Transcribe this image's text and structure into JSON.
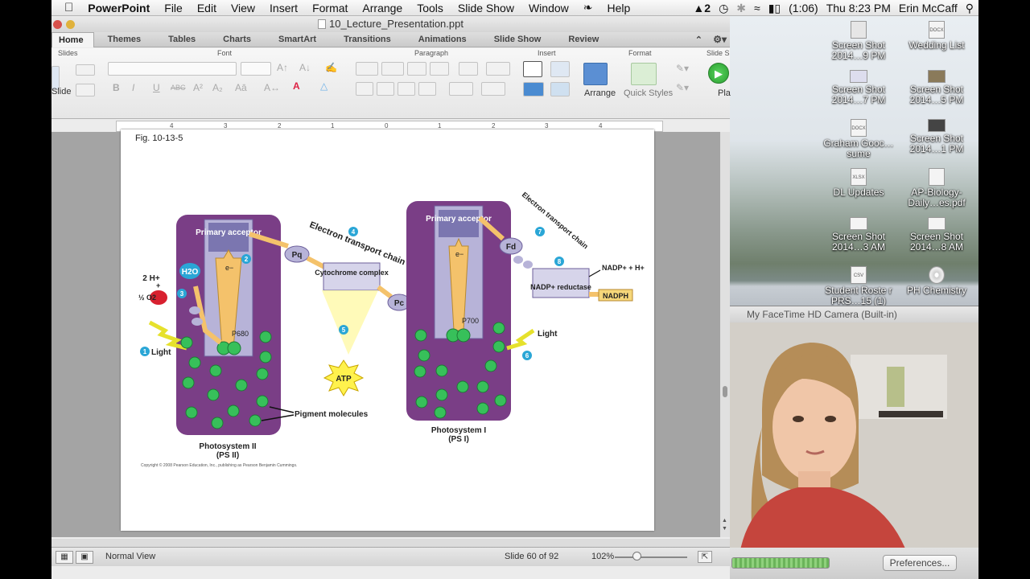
{
  "menubar": {
    "apple_icon": "apple-icon",
    "app_name": "PowerPoint",
    "menus": [
      "File",
      "Edit",
      "View",
      "Insert",
      "Format",
      "Arrange",
      "Tools",
      "Slide Show",
      "Window",
      "Help"
    ],
    "adobe_badge": "2",
    "battery": "(1:06)",
    "clock": "Thu 8:23 PM",
    "user": "Erin McCaff"
  },
  "window": {
    "title": "10_Lecture_Presentation.ppt"
  },
  "ribbon": {
    "tabs": [
      "Home",
      "Themes",
      "Tables",
      "Charts",
      "SmartArt",
      "Transitions",
      "Animations",
      "Slide Show",
      "Review"
    ],
    "active_tab": "Home",
    "groups": [
      "Slides",
      "Font",
      "Paragraph",
      "Insert",
      "Format",
      "Slide S"
    ],
    "slide_label": "Slide",
    "arrange_label": "Arrange",
    "quick_styles_label": "Quick Styles",
    "play_label": "Pla"
  },
  "ruler_ticks": [
    "4",
    "3",
    "2",
    "1",
    "0",
    "1",
    "2",
    "3",
    "4"
  ],
  "slide": {
    "fig_label": "Fig. 10-13-5",
    "copyright": "Copyright © 2008 Pearson Education, Inc., publishing as Pearson Benjamin Cummings.",
    "ps2": {
      "primary_acceptor": "Primary acceptor",
      "title_line1": "Photosystem II",
      "title_line2": "(PS II)",
      "p680": "P680",
      "water": "H2O",
      "two_h": "2 H+",
      "plus": "+",
      "half_o2": "½ O2",
      "light": "Light",
      "step1": "1",
      "step2": "2",
      "step3": "3",
      "electron": "e−"
    },
    "etc": {
      "label": "Electron transport chain",
      "pq": "Pq",
      "cytochrome": "Cytochrome complex",
      "pc": "Pc",
      "step4": "4",
      "step5": "5",
      "atp": "ATP"
    },
    "ps1": {
      "primary_acceptor": "Primary acceptor",
      "title_line1": "Photosystem I",
      "title_line2": "(PS I)",
      "p700": "P700",
      "light": "Light",
      "step6": "6",
      "etc2": "Electron transport chain",
      "step7": "7",
      "fd": "Fd",
      "step8": "8",
      "nadp_reductase": "NADP+ reductase",
      "nadp_in": "NADP+ + H+",
      "nadph": "NADPH",
      "electron": "e−"
    },
    "pigment": "Pigment molecules"
  },
  "status": {
    "view": "Normal View",
    "slide_count": "Slide 60 of 92",
    "zoom": "102%"
  },
  "desktop": {
    "icons": [
      {
        "label": "Screen Shot 2014…9 PM",
        "type": "png"
      },
      {
        "label": "Wedding List",
        "type": "docx"
      },
      {
        "label": "Screen Shot 2014…7 PM",
        "type": "png"
      },
      {
        "label": "Screen Shot 2014…5 PM",
        "type": "png"
      },
      {
        "label": "Graham Gooc…sume",
        "type": "docx"
      },
      {
        "label": "Screen Shot 2014…1 PM",
        "type": "png"
      },
      {
        "label": "DL Updates",
        "type": "xlsx"
      },
      {
        "label": "AP-Biology-Daily…es.pdf",
        "type": "pdf"
      },
      {
        "label": "Screen Shot 2014…3 AM",
        "type": "png"
      },
      {
        "label": "Screen Shot 2014…8 AM",
        "type": "png"
      },
      {
        "label": "Student Roste r PRS…15 (1)",
        "type": "csv"
      },
      {
        "label": "PH Chemistry",
        "type": "disc"
      }
    ]
  },
  "facetime": {
    "title": "My FaceTime HD Camera (Built-in)",
    "preferences": "Preferences..."
  },
  "colors": {
    "ps_purple": "#7a3e86",
    "ps_inner": "#b7b3d8",
    "pigment_green": "#37c05a",
    "arrow_gold": "#f4c26b",
    "step_blue": "#2aa6d6",
    "atp_yellow": "#fff24d",
    "nadph_gold": "#f6d77a"
  }
}
